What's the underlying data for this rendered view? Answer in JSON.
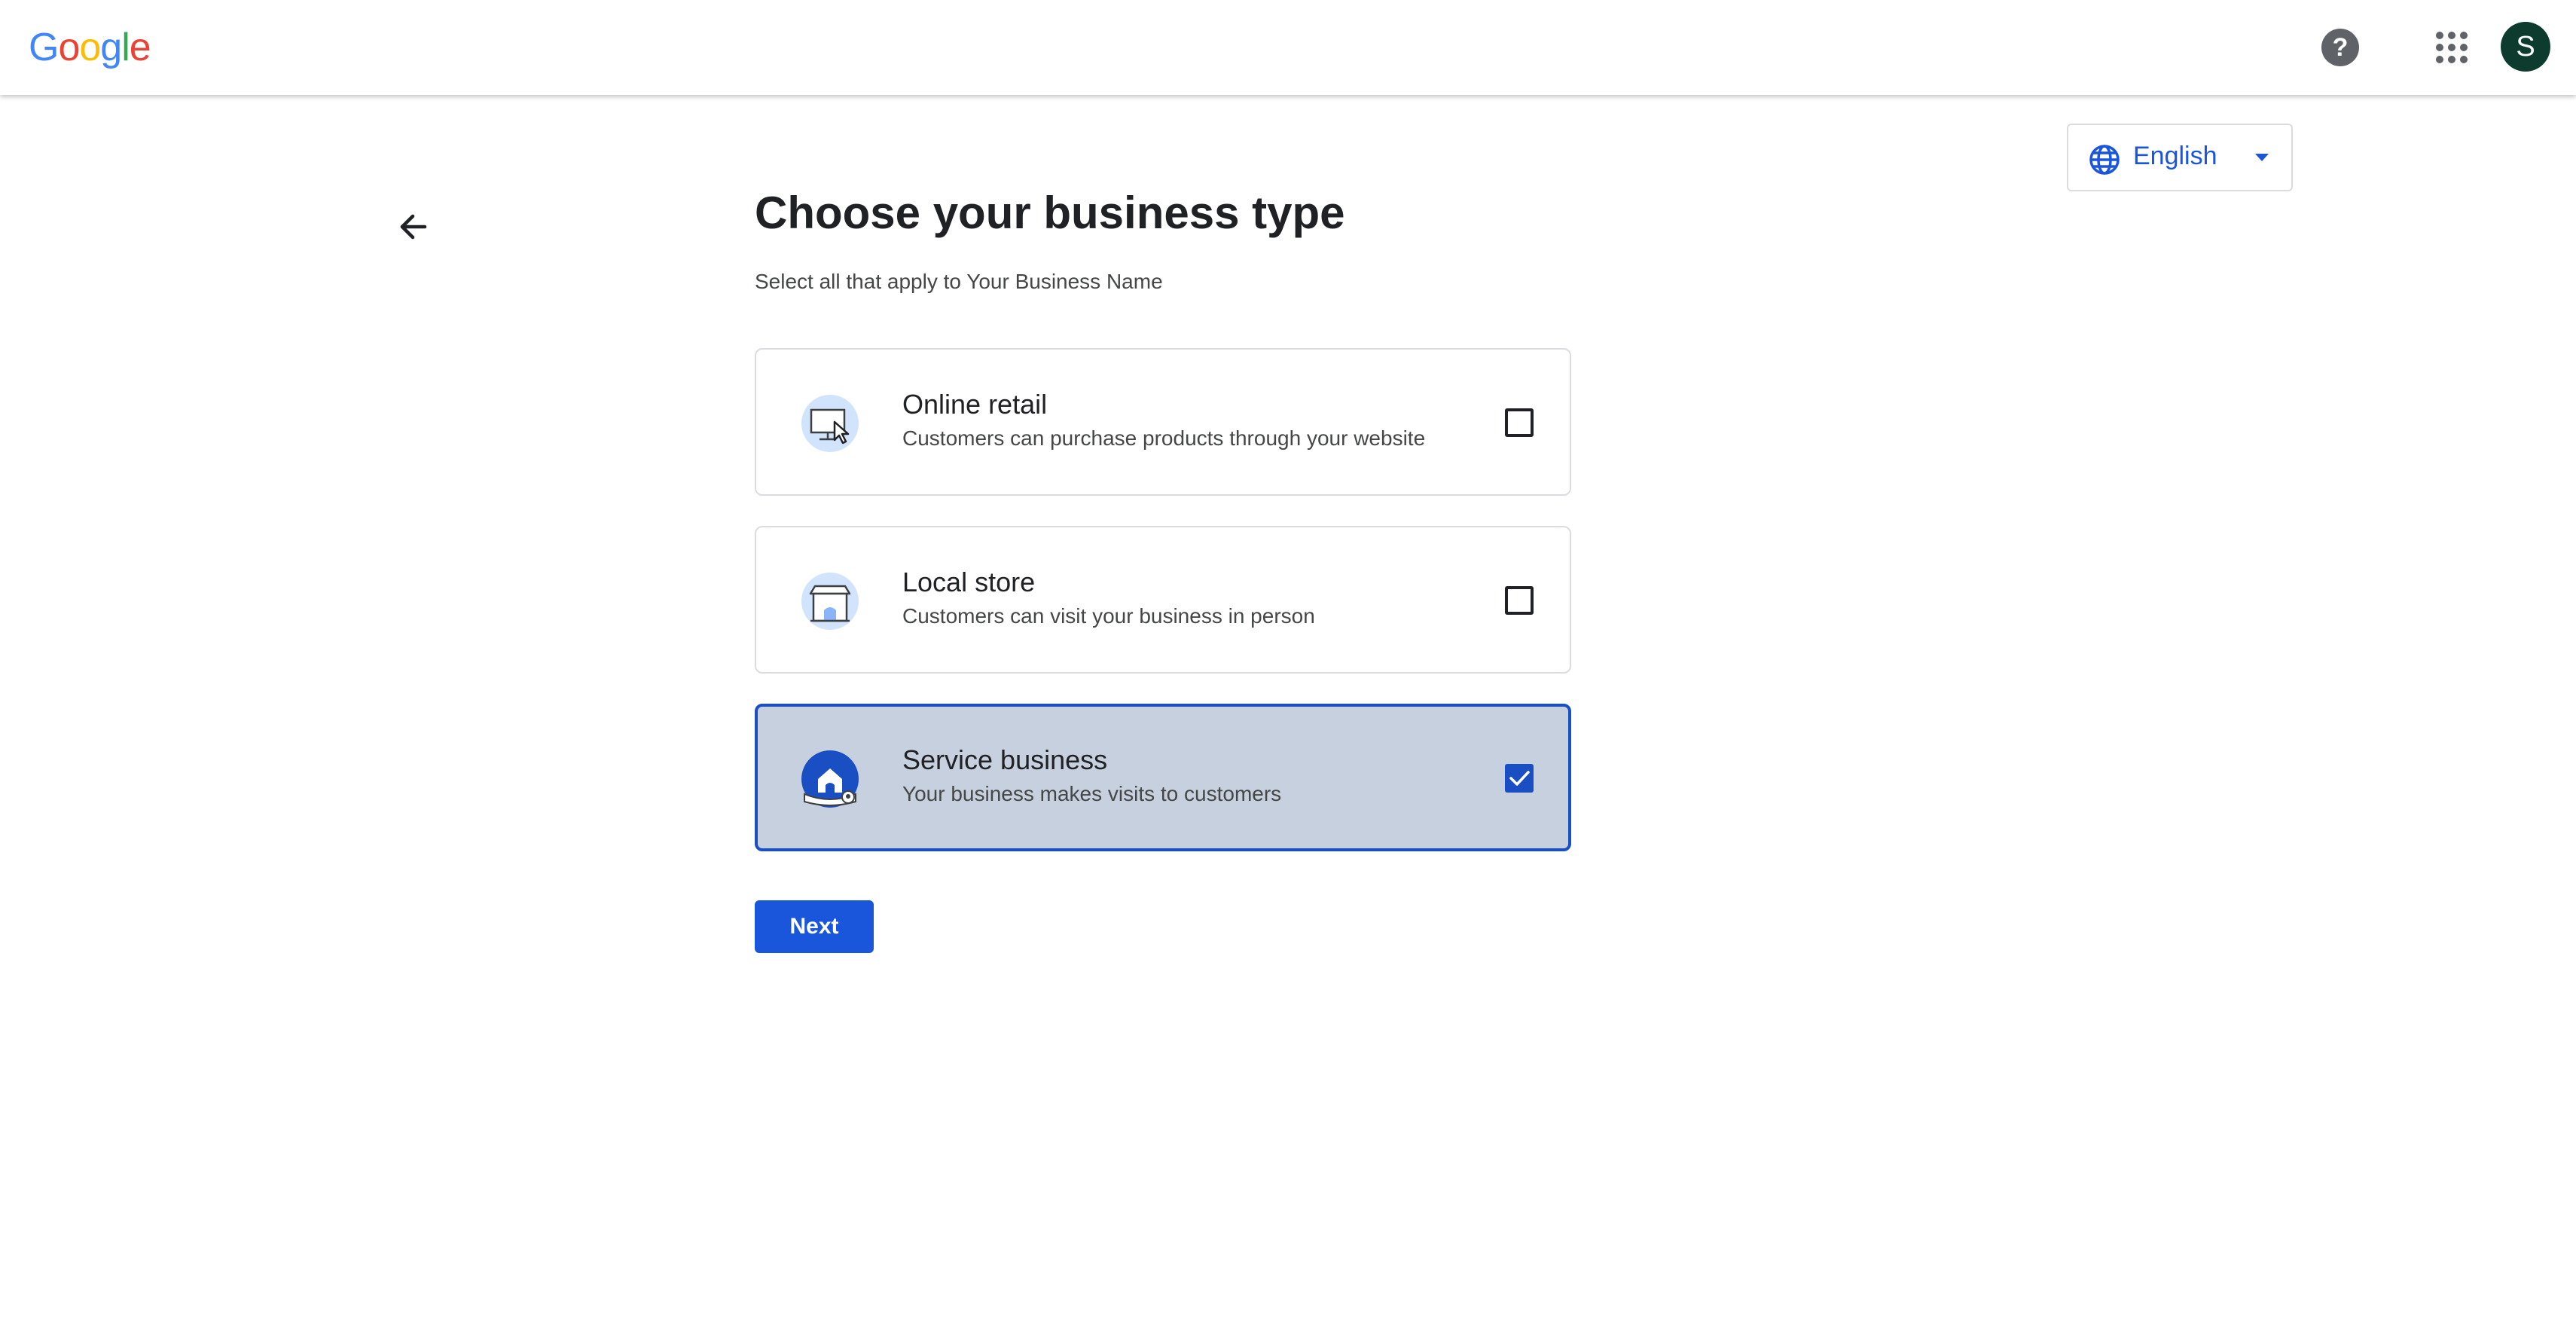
{
  "header": {
    "logo_letters": [
      {
        "char": "G",
        "color": "#4285F4"
      },
      {
        "char": "o",
        "color": "#EA4335"
      },
      {
        "char": "o",
        "color": "#FBBC05"
      },
      {
        "char": "g",
        "color": "#4285F4"
      },
      {
        "char": "l",
        "color": "#34A853"
      },
      {
        "char": "e",
        "color": "#EA4335"
      }
    ],
    "help_icon": "help-circle-icon",
    "help_glyph": "?",
    "apps_icon": "apps-grid-icon",
    "avatar_initial": "S",
    "avatar_color": "#0d3b2e"
  },
  "language": {
    "label": "English",
    "icon": "globe-icon",
    "caret_icon": "caret-down-icon"
  },
  "main": {
    "back_icon": "arrow-back-icon",
    "title": "Choose your business type",
    "subtitle": "Select all that apply to Your Business Name",
    "options": [
      {
        "title": "Online retail",
        "description": "Customers can purchase products through your website",
        "icon": "computer-cursor-icon",
        "selected": false
      },
      {
        "title": "Local store",
        "description": "Customers can visit your business in person",
        "icon": "storefront-icon",
        "selected": false
      },
      {
        "title": "Service business",
        "description": "Your business makes visits to customers",
        "icon": "home-service-icon",
        "selected": true
      }
    ],
    "next_label": "Next"
  },
  "colors": {
    "accent": "#1a56db",
    "selected_border": "#1a4fc4",
    "selected_background": "#c7d0de"
  }
}
